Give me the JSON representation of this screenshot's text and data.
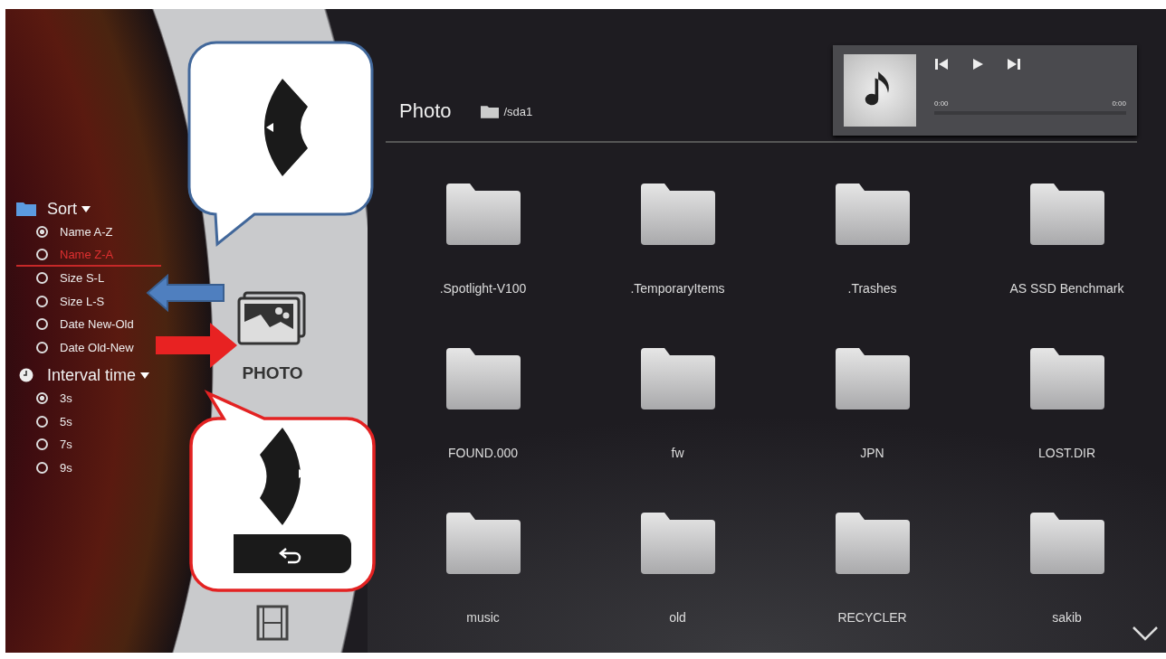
{
  "sidebar": {
    "sort": {
      "label": "Sort",
      "options": [
        {
          "label": "Name A-Z",
          "selected": true,
          "focused": false
        },
        {
          "label": "Name Z-A",
          "selected": false,
          "focused": true
        },
        {
          "label": "Size S-L",
          "selected": false,
          "focused": false
        },
        {
          "label": "Size L-S",
          "selected": false,
          "focused": false
        },
        {
          "label": "Date New-Old",
          "selected": false,
          "focused": false
        },
        {
          "label": "Date Old-New",
          "selected": false,
          "focused": false
        }
      ]
    },
    "interval": {
      "label": "Interval time",
      "options": [
        {
          "label": "3s",
          "selected": true,
          "focused": false
        },
        {
          "label": "5s",
          "selected": false,
          "focused": false
        },
        {
          "label": "7s",
          "selected": false,
          "focused": false
        },
        {
          "label": "9s",
          "selected": false,
          "focused": false
        }
      ]
    }
  },
  "wheel": {
    "label": "PHOTO"
  },
  "header": {
    "title": "Photo",
    "path": "/sda1"
  },
  "player": {
    "time_elapsed": "0:00",
    "time_total": "0:00",
    "level": 0
  },
  "folders": [
    {
      "name": ".Spotlight-V100"
    },
    {
      "name": ".TemporaryItems"
    },
    {
      "name": ".Trashes"
    },
    {
      "name": "AS SSD Benchmark"
    },
    {
      "name": "FOUND.000"
    },
    {
      "name": "fw"
    },
    {
      "name": "JPN"
    },
    {
      "name": "LOST.DIR"
    },
    {
      "name": "music"
    },
    {
      "name": "old"
    },
    {
      "name": "RECYCLER"
    },
    {
      "name": "sakib"
    }
  ]
}
